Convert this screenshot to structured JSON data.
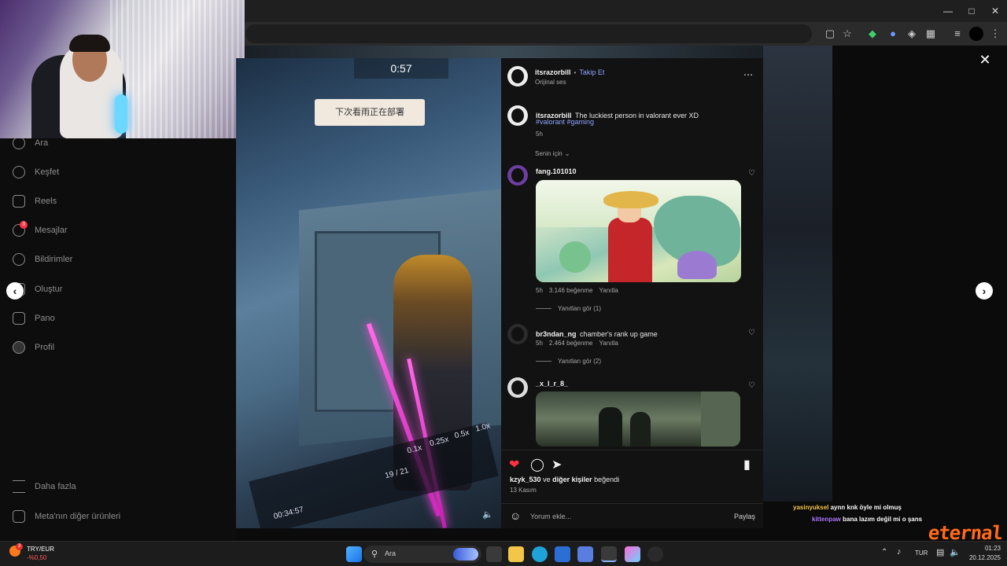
{
  "sidebar": {
    "items": [
      {
        "label": "Ara",
        "icon": "search-icon"
      },
      {
        "label": "Keşfet",
        "icon": "compass-icon"
      },
      {
        "label": "Reels",
        "icon": "reels-icon"
      },
      {
        "label": "Mesajlar",
        "icon": "messenger-icon",
        "badge": "3"
      },
      {
        "label": "Bildirimler",
        "icon": "heart-icon"
      },
      {
        "label": "Oluştur",
        "icon": "plus-icon"
      },
      {
        "label": "Pano",
        "icon": "dashboard-icon"
      },
      {
        "label": "Profil",
        "icon": "profile-icon"
      }
    ],
    "more": "Daha fazla",
    "meta": "Meta'nın diğer ürünleri"
  },
  "video": {
    "sign_text": "下次看雨正在部署",
    "hud_time": "0:57",
    "timeline_time": "00:34:57",
    "timeline_pages": "19 / 21",
    "speeds": [
      "0.1x",
      "0.25x",
      "0.5x",
      "1.0x"
    ]
  },
  "post": {
    "author": "itsrazorbill",
    "follow": "Takip Et",
    "audio": "Orijinal ses",
    "caption_text": "The luckiest person in valorant ever XD",
    "hashtags": "#valorant #gaming",
    "caption_time": "5h",
    "filter": "Senin için",
    "liked_by_prefix": "kzyk_530",
    "liked_by_mid": "ve",
    "liked_by_others": "diğer kişiler",
    "liked_by_suffix": "beğendi",
    "date": "13 Kasım",
    "comment_placeholder": "Yorum ekle...",
    "share": "Paylaş"
  },
  "comments": [
    {
      "user": "fang.101010",
      "text": "",
      "time": "5h",
      "likes": "3.146 beğenme",
      "reply": "Yanıtla",
      "replies": "Yanıtları gör (1)"
    },
    {
      "user": "br3ndan_ng",
      "text": "chamber's rank up game",
      "time": "5h",
      "likes": "2.464 beğenme",
      "reply": "Yanıtla",
      "replies": "Yanıtları gör (2)"
    },
    {
      "user": "_x_l_r_8_",
      "text": "",
      "time": "",
      "likes": "",
      "reply": "",
      "replies": ""
    }
  ],
  "chat": [
    {
      "user": "yasinyuksel",
      "text": "aynn knk öyle mi olmuş"
    },
    {
      "user": "kittenpaw",
      "text": "bana lazım değil mi o şans"
    }
  ],
  "overlay_logo": "eternal",
  "taskbar": {
    "ticker": "TRY/EUR",
    "ticker_change": "-%0,50",
    "ticker_badge": "3",
    "search": "Ara",
    "lang": "TUR",
    "time": "01:23",
    "date": "20.12.2025"
  },
  "colors": {
    "accent_blue": "#8fa3ff",
    "like_red": "#ff3040",
    "panel_bg": "#121212",
    "brand_orange": "#ff6a1a"
  }
}
